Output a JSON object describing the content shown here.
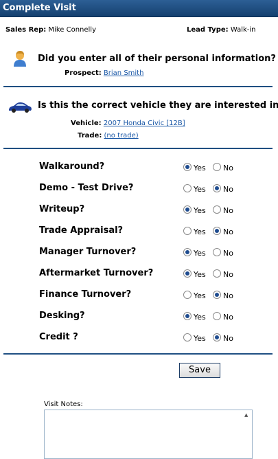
{
  "header": {
    "title": "Complete Visit"
  },
  "info": {
    "sales_rep_label": "Sales Rep:",
    "sales_rep": "Mike Connelly",
    "lead_type_label": "Lead Type:",
    "lead_type": "Walk-in"
  },
  "personal": {
    "question": "Did you enter all of their personal information?",
    "prospect_label": "Prospect:",
    "prospect": "Brian Smith"
  },
  "vehicle": {
    "question": "Is this the correct vehicle they are interested in?",
    "vehicle_label": "Vehicle:",
    "vehicle": "2007 Honda Civic [12B]",
    "trade_label": "Trade:",
    "trade": "(no trade)"
  },
  "steps": [
    {
      "label": "Walkaround?",
      "yes": "Yes",
      "no": "No",
      "selected": "yes"
    },
    {
      "label": "Demo - Test Drive?",
      "yes": "Yes",
      "no": "No",
      "selected": "no"
    },
    {
      "label": "Writeup?",
      "yes": "Yes",
      "no": "No",
      "selected": "yes"
    },
    {
      "label": "Trade Appraisal?",
      "yes": "Yes",
      "no": "No",
      "selected": "no"
    },
    {
      "label": "Manager Turnover?",
      "yes": "Yes",
      "no": "No",
      "selected": "yes"
    },
    {
      "label": "Aftermarket Turnover?",
      "yes": "Yes",
      "no": "No",
      "selected": "yes"
    },
    {
      "label": "Finance Turnover?",
      "yes": "Yes",
      "no": "No",
      "selected": "no"
    },
    {
      "label": "Desking?",
      "yes": "Yes",
      "no": "No",
      "selected": "yes"
    },
    {
      "label": "Credit ?",
      "yes": "Yes",
      "no": "No",
      "selected": "no"
    }
  ],
  "actions": {
    "save": "Save"
  },
  "notes": {
    "label": "Visit Notes:",
    "value": ""
  },
  "colors": {
    "header": "#1f4f82",
    "divider": "#1f4f82",
    "link": "#1d5aa8"
  }
}
